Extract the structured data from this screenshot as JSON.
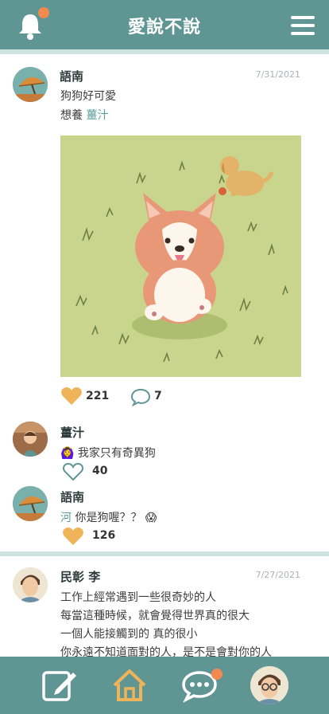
{
  "header": {
    "logo_text": "愛說不說",
    "bell_icon": "bell-icon",
    "menu_icon": "menu-icon",
    "notification_dot_color": "#f2894f"
  },
  "colors": {
    "primary": "#5f9593",
    "accent": "#f2894f",
    "heart": "#efb45a",
    "mention": "#5a9e9c"
  },
  "post": {
    "author": "語南",
    "date": "7/31/2021",
    "line1": "狗狗好可愛",
    "line2_prefix": "想養",
    "line2_mention": "薑汁",
    "likes": "221",
    "comments": "7"
  },
  "comments": [
    {
      "author": "薑汁",
      "emoji": "🙆‍♀️",
      "text": "我家只有奇異狗",
      "likes": "40",
      "liked": false
    },
    {
      "author": "語南",
      "mention": "河",
      "text": "你是狗喔？？",
      "emoji": "😱",
      "likes": "126",
      "liked": true
    }
  ],
  "post2": {
    "author": "民彰 李",
    "date": "7/27/2021",
    "lines": [
      "工作上經常遇到一些很奇妙的人",
      "每當這種時候，就會覺得世界真的很大",
      "一個人能接觸到的 真的很小",
      "你永遠不知道面對的人，是不是會對你的人"
    ]
  },
  "bottom_nav": [
    {
      "icon": "compose-icon"
    },
    {
      "icon": "home-icon"
    },
    {
      "icon": "chat-icon"
    },
    {
      "icon": "profile-avatar"
    }
  ]
}
